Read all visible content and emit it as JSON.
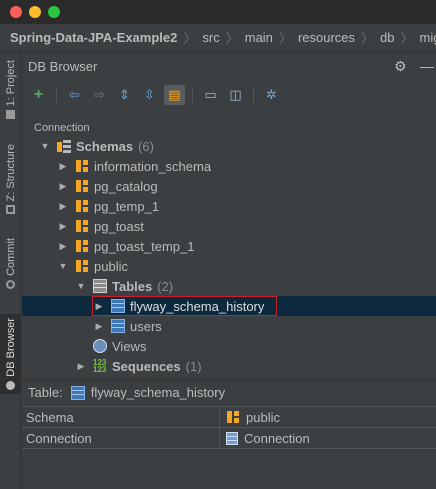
{
  "breadcrumb": [
    "Spring-Data-JPA-Example2",
    "src",
    "main",
    "resources",
    "db",
    "migration"
  ],
  "left_tabs": [
    {
      "label": "1: Project",
      "icon": "folder-icon"
    },
    {
      "label": "Z: Structure",
      "icon": "structure-icon"
    },
    {
      "label": "Commit",
      "icon": "commit-icon"
    },
    {
      "label": "DB Browser",
      "icon": "db-browser-icon"
    }
  ],
  "panel": {
    "title": "DB Browser",
    "header_icons": [
      "gear-icon",
      "minimize-icon"
    ],
    "toolbar": [
      "add-icon",
      "back-icon",
      "forward-icon",
      "expand-all-icon",
      "collapse-all-icon",
      "filter-icon",
      "open-sql-console-icon",
      "schema-compare-icon",
      "settings-icon"
    ],
    "connection_label": "Connection"
  },
  "tree": {
    "schemas": {
      "label": "Schemas",
      "count": "(6)"
    },
    "schema_items": [
      "information_schema",
      "pg_catalog",
      "pg_temp_1",
      "pg_toast",
      "pg_toast_temp_1"
    ],
    "public": {
      "label": "public"
    },
    "tables": {
      "label": "Tables",
      "count": "(2)"
    },
    "table_items": [
      "flyway_schema_history",
      "users"
    ],
    "views": {
      "label": "Views"
    },
    "sequences": {
      "label": "Sequences",
      "count": "(1)"
    }
  },
  "details": {
    "title_prefix": "Table:",
    "title_value": "flyway_schema_history",
    "rows": [
      {
        "key": "Schema",
        "value": "public"
      },
      {
        "key": "Connection",
        "value": "Connection"
      }
    ]
  },
  "colors": {
    "accent_orange": "#f5a623",
    "selection": "#0d293e",
    "highlight_border": "#c7222a"
  }
}
